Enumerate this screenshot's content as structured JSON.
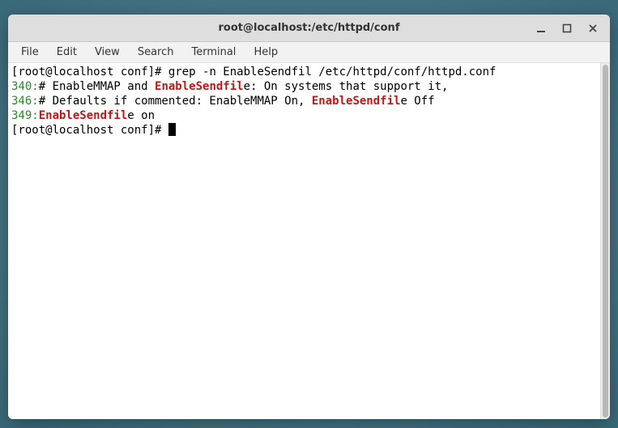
{
  "window": {
    "title": "root@localhost:/etc/httpd/conf"
  },
  "menubar": {
    "items": [
      "File",
      "Edit",
      "View",
      "Search",
      "Terminal",
      "Help"
    ]
  },
  "terminal": {
    "prompt": "[root@localhost conf]# ",
    "command": "grep -n EnableSendfil /etc/httpd/conf/httpd.conf",
    "lines": [
      {
        "num": "340:",
        "pre": "# EnableMMAP and ",
        "match": "EnableSendfil",
        "post": "e: On systems that support it,"
      },
      {
        "num": "346:",
        "pre": "# Defaults if commented: EnableMMAP On, ",
        "match": "EnableSendfil",
        "post": "e Off"
      },
      {
        "num": "349:",
        "pre": "",
        "match": "EnableSendfil",
        "post": "e on"
      }
    ],
    "prompt2": "[root@localhost conf]# "
  }
}
